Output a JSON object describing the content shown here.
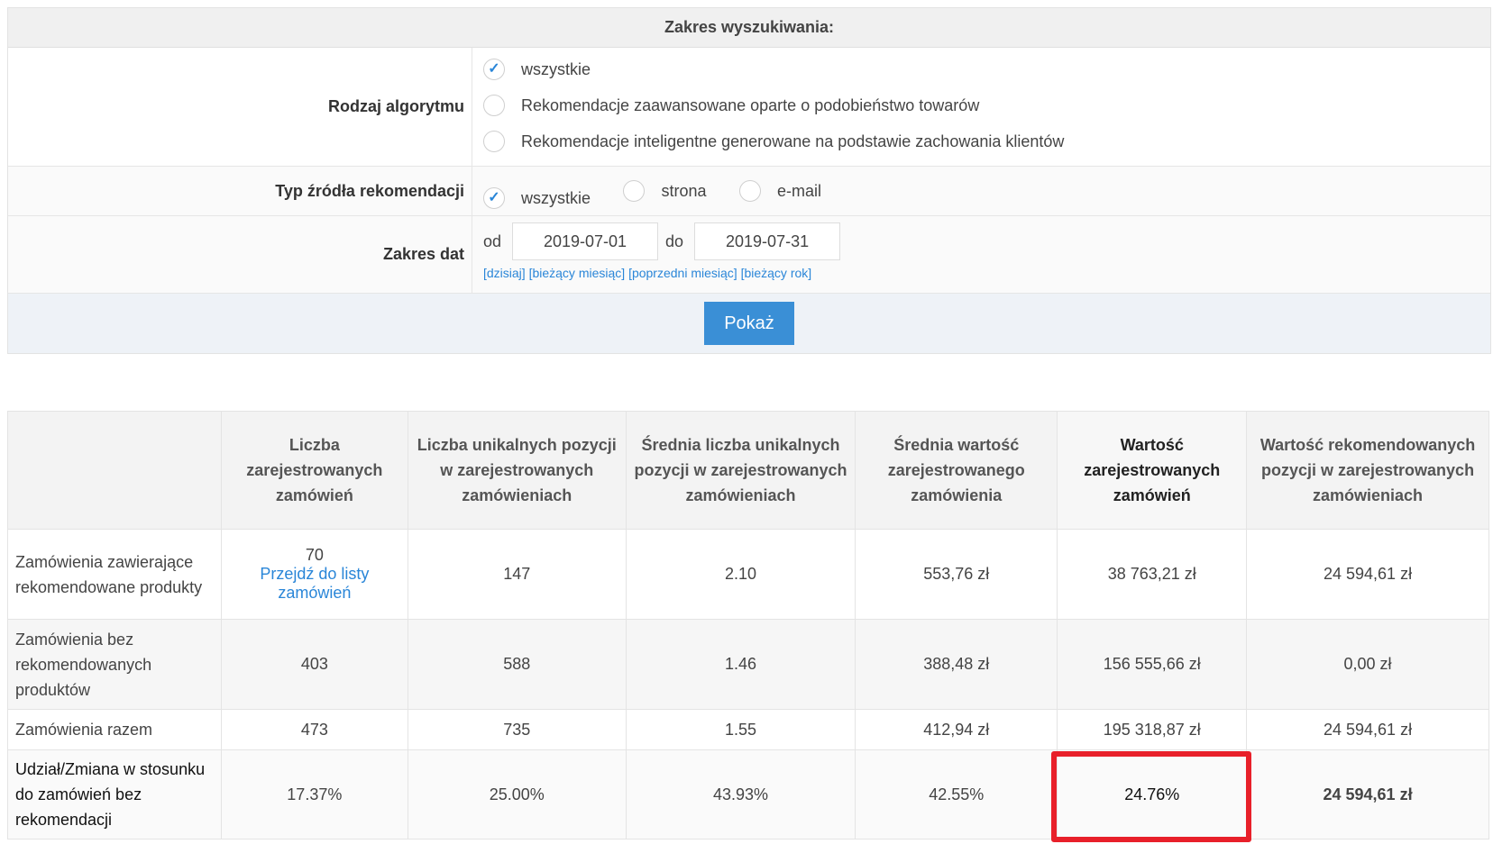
{
  "search": {
    "title": "Zakres wyszukiwania:",
    "algorithm": {
      "label": "Rodzaj algorytmu",
      "options": [
        {
          "label": "wszystkie",
          "checked": true
        },
        {
          "label": "Rekomendacje zaawansowane oparte o podobieństwo towarów",
          "checked": false
        },
        {
          "label": "Rekomendacje inteligentne generowane na podstawie zachowania klientów",
          "checked": false
        }
      ]
    },
    "source": {
      "label": "Typ źródła rekomendacji",
      "options": [
        {
          "label": "wszystkie",
          "checked": true
        },
        {
          "label": "strona",
          "checked": false
        },
        {
          "label": "e-mail",
          "checked": false
        }
      ]
    },
    "dates": {
      "label": "Zakres dat",
      "from_label": "od",
      "from_value": "2019-07-01",
      "to_label": "do",
      "to_value": "2019-07-31",
      "quick_links": [
        "[dzisiaj]",
        "[bieżący miesiąc]",
        "[poprzedni miesiąc]",
        "[bieżący rok]"
      ]
    },
    "submit_label": "Pokaż"
  },
  "table": {
    "headers": [
      "",
      "Liczba zarejestrowanych zamówień",
      "Liczba unikalnych pozycji w zarejestrowanych zamówieniach",
      "Średnia liczba unikalnych pozycji w zarejestrowanych zamówieniach",
      "Średnia wartość zarejestrowanego zamówienia",
      "Wartość zarejestrowanych zamówień",
      "Wartość rekomendowanych pozycji w zarejestrowanych zamówieniach"
    ],
    "rows": [
      {
        "label": "Zamówienia zawierające rekomendowane produkty",
        "count": "70",
        "link": "Przejdź do listy zamówień",
        "cells": [
          "147",
          "2.10",
          "553,76 zł",
          "38 763,21 zł",
          "24 594,61 zł"
        ]
      },
      {
        "label": "Zamówienia bez rekomendowanych produktów",
        "count": "403",
        "cells": [
          "588",
          "1.46",
          "388,48 zł",
          "156 555,66 zł",
          "0,00 zł"
        ]
      },
      {
        "label": "Zamówienia razem",
        "count": "473",
        "cells": [
          "735",
          "1.55",
          "412,94 zł",
          "195 318,87 zł",
          "24 594,61 zł"
        ]
      },
      {
        "label": "Udział/Zmiana w stosunku do zamówień bez rekomendacji",
        "count": "17.37%",
        "cells": [
          "25.00%",
          "43.93%",
          "42.55%",
          "24.76%",
          "24 594,61 zł"
        ]
      }
    ],
    "highlight_color": "#e8202a"
  }
}
